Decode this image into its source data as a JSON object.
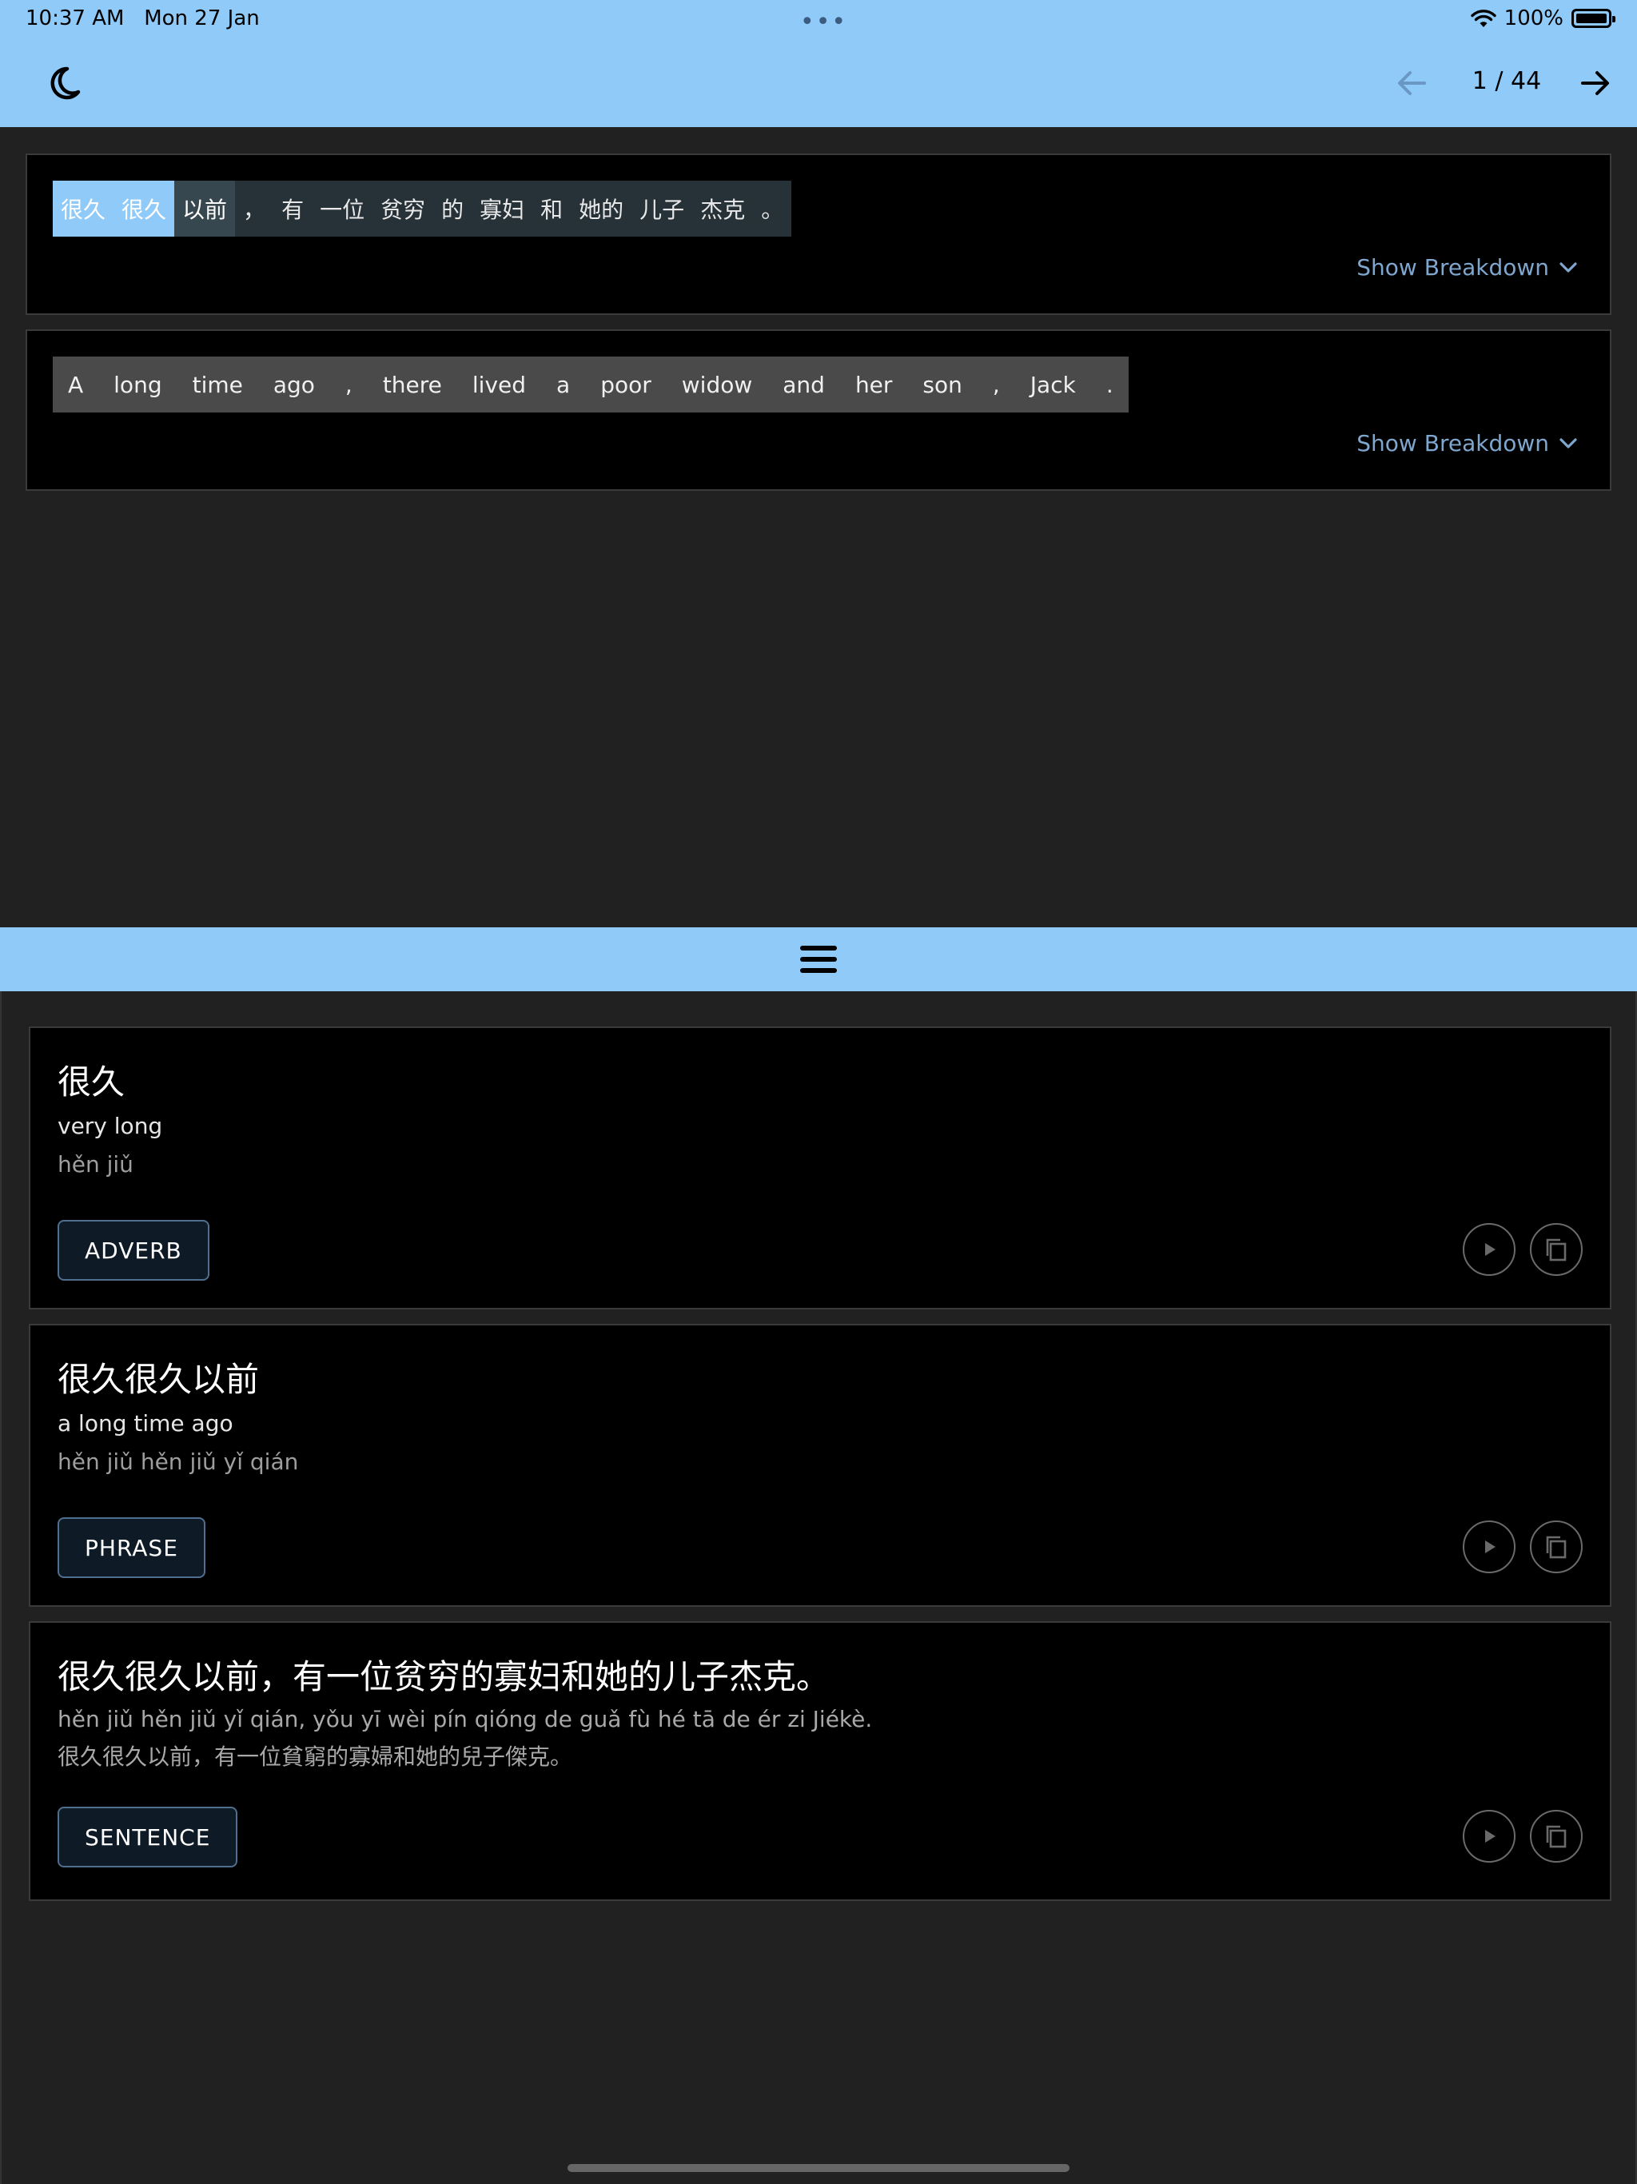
{
  "status_bar": {
    "time": "10:37 AM",
    "date": "Mon 27 Jan",
    "dots": "•••",
    "battery": "100%"
  },
  "toolbar": {
    "theme_icon": "moon-icon",
    "prev_icon": "arrow-left-icon",
    "next_icon": "arrow-right-icon",
    "page_indicator": "1 / 44"
  },
  "chinese_sentence": {
    "tokens": [
      "很久",
      "很久",
      "以前",
      "，",
      "有",
      "一位",
      "贫穷",
      "的",
      "寡妇",
      "和",
      "她的",
      "儿子",
      "杰克",
      "。"
    ],
    "show_breakdown": "Show Breakdown"
  },
  "english_sentence": {
    "tokens": [
      "A",
      "long",
      "time",
      "ago",
      ",",
      "there",
      "lived",
      "a",
      "poor",
      "widow",
      "and",
      "her",
      "son",
      ",",
      "Jack",
      "."
    ],
    "show_breakdown": "Show Breakdown"
  },
  "colors": {
    "accent": "#90caf9",
    "background": "#212121",
    "card": "#000000",
    "link": "#7ea6cf"
  },
  "dictionary": {
    "entries": [
      {
        "title": "很久",
        "meaning": "very long",
        "pinyin": "hěn jiǔ",
        "tag": "ADVERB"
      },
      {
        "title": "很久很久以前",
        "meaning": "a long time ago",
        "pinyin": "hěn jiǔ hěn jiǔ yǐ qián",
        "tag": "PHRASE"
      },
      {
        "title": "很久很久以前，有一位贫穷的寡妇和她的儿子杰克。",
        "pinyin": "hěn jiǔ hěn jiǔ yǐ qián, yǒu yī wèi pín qióng de guǎ fù hé tā de ér zi Jiékè.",
        "traditional": "很久很久以前，有一位貧窮的寡婦和她的兒子傑克。",
        "tag": "SENTENCE"
      }
    ]
  }
}
